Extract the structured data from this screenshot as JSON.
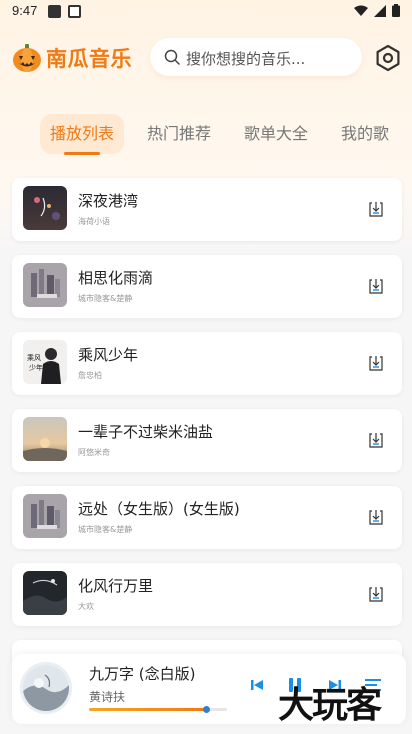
{
  "status_bar": {
    "time": "9:47"
  },
  "header": {
    "app_title": "南瓜音乐",
    "search_placeholder": "搜你想搜的音乐..."
  },
  "tabs": [
    {
      "label": "播放列表",
      "active": true
    },
    {
      "label": "热门推荐",
      "active": false
    },
    {
      "label": "歌单大全",
      "active": false
    },
    {
      "label": "我的歌",
      "active": false
    }
  ],
  "songs": [
    {
      "title": "深夜港湾",
      "artist": "海荷小语"
    },
    {
      "title": "相思化雨滴",
      "artist": "城市隐客&楚静"
    },
    {
      "title": "乘风少年",
      "artist": "詹忠柏"
    },
    {
      "title": "一辈子不过柴米油盐",
      "artist": "阿悠米奇"
    },
    {
      "title": "远处（女生版）(女生版)",
      "artist": "城市隐客&楚静"
    },
    {
      "title": "化风行万里",
      "artist": "大欢"
    }
  ],
  "player": {
    "title": "九万字 (念白版)",
    "artist": "黄诗扶",
    "progress": 0.85
  },
  "watermark": "大玩客",
  "colors": {
    "accent": "#f07a14",
    "accent_light": "#ffe9d2",
    "progress_knob": "#2f7fd8",
    "control_blue": "#1a8fe3"
  }
}
